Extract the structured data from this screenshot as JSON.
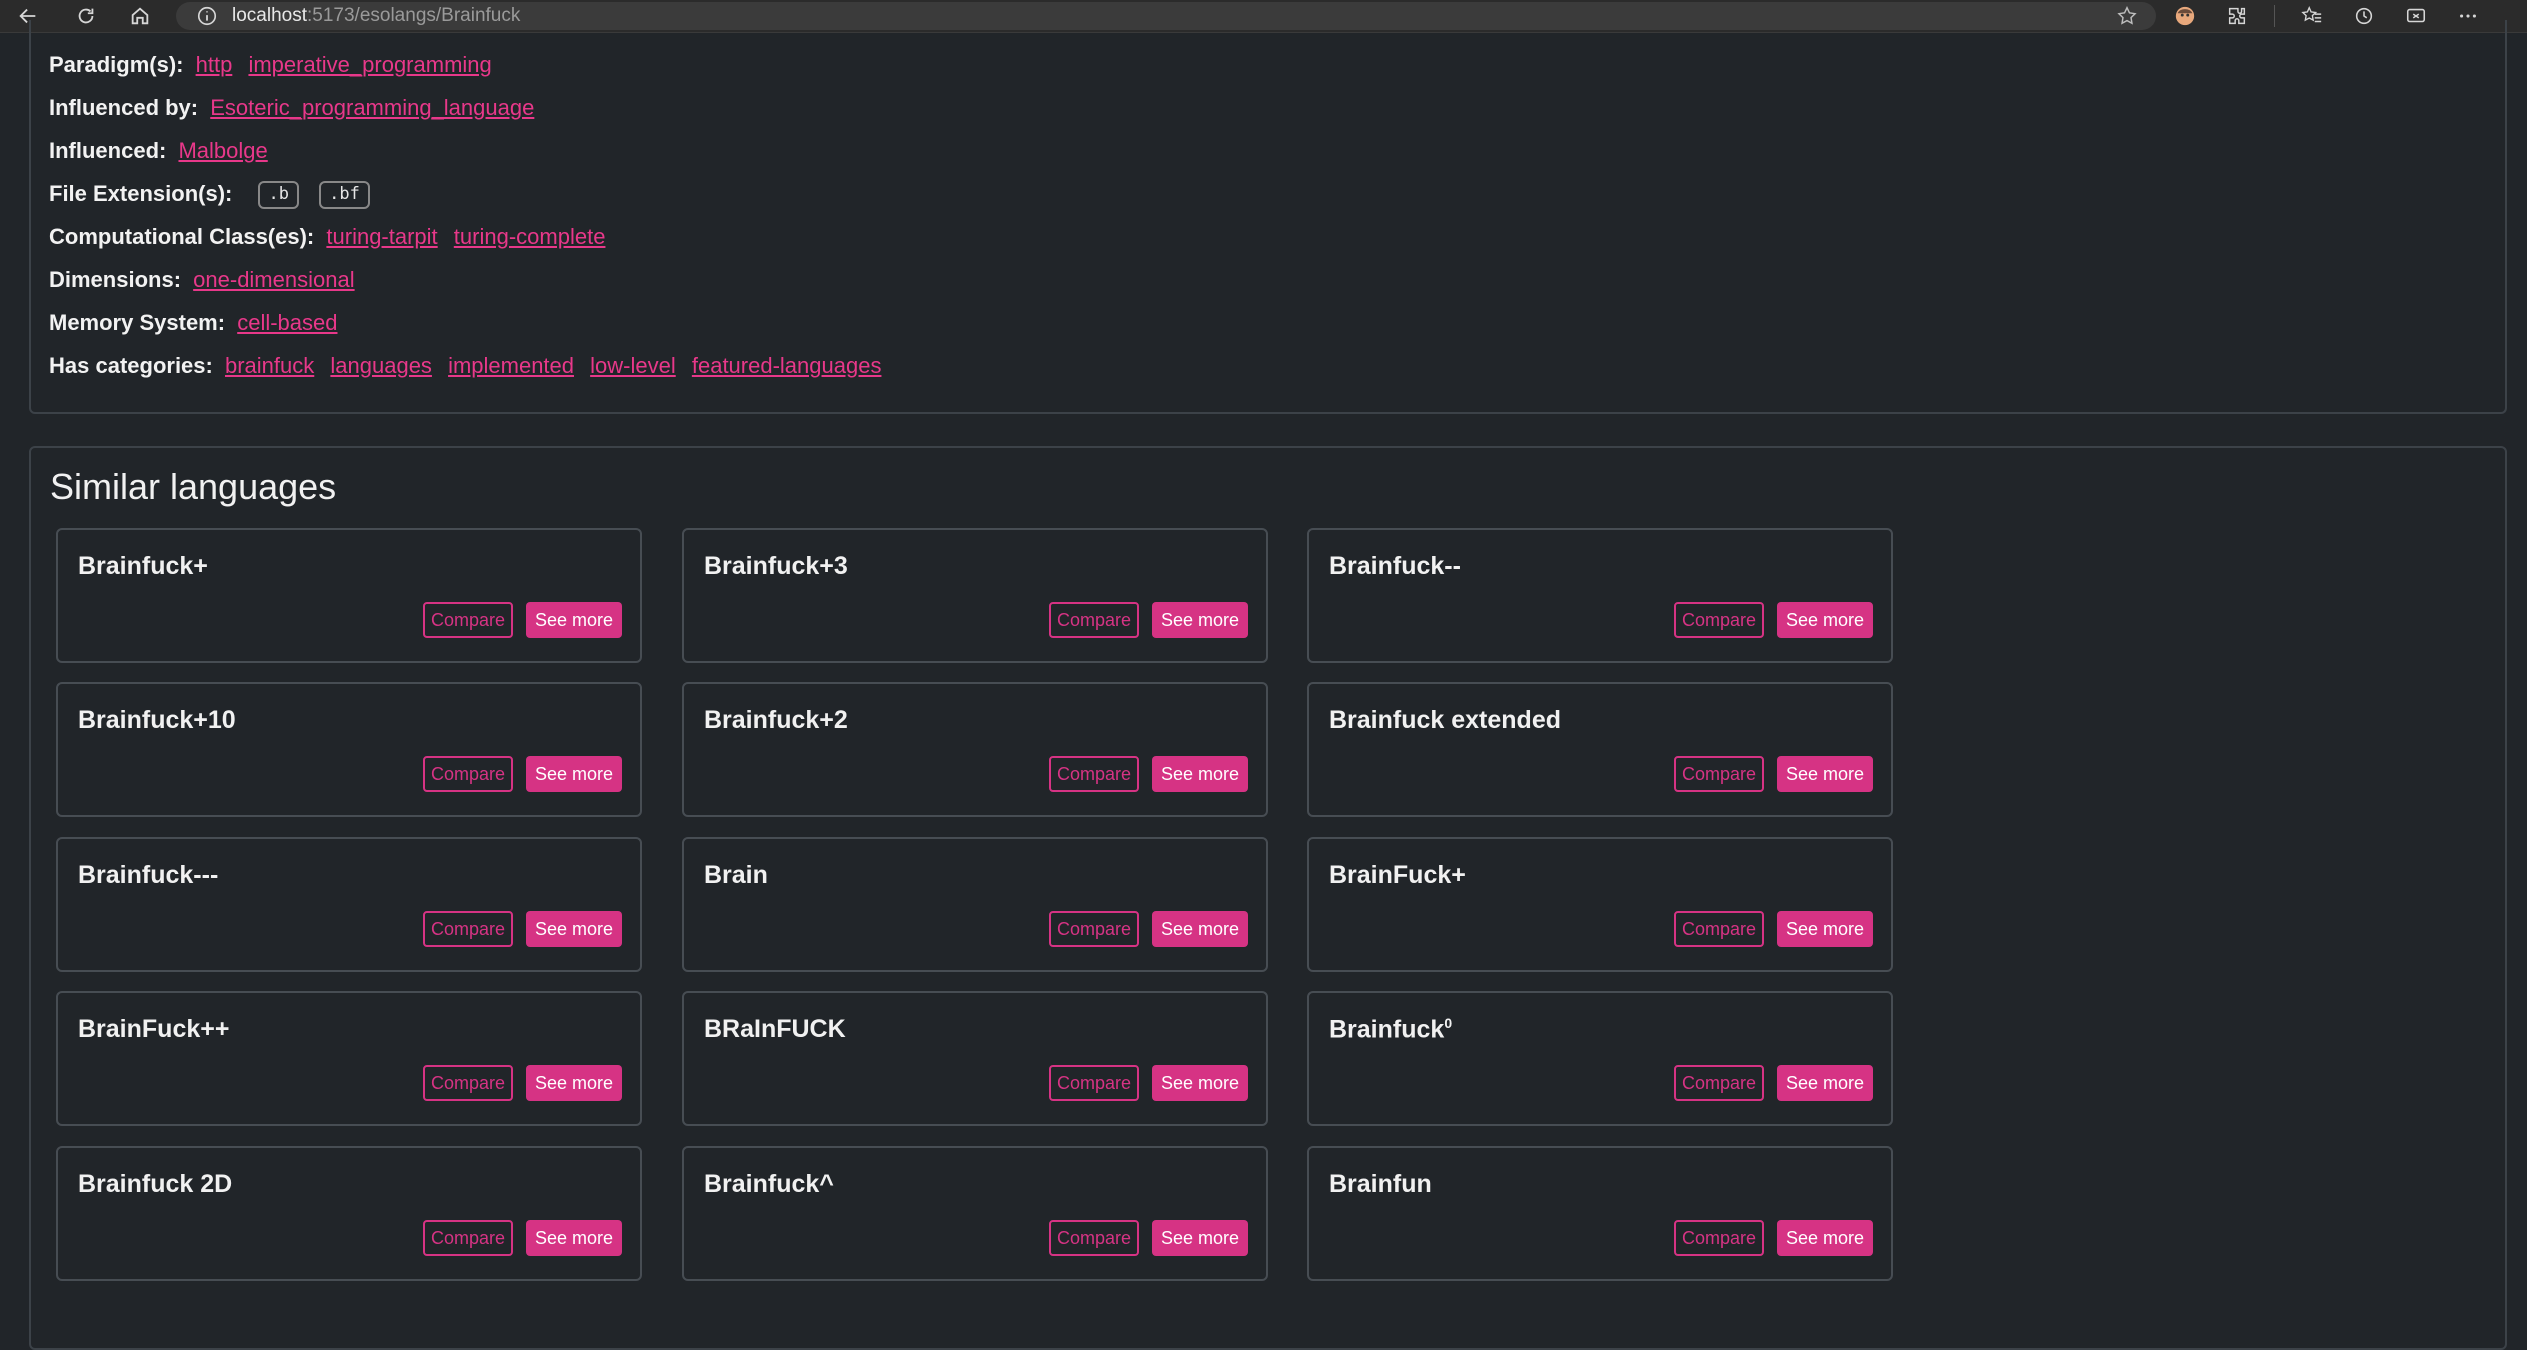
{
  "browser": {
    "url_host": "localhost",
    "url_rest": ":5173/esolangs/Brainfuck"
  },
  "info": {
    "paradigm_label": "Paradigm(s):",
    "paradigm_links": [
      "http",
      "imperative_programming"
    ],
    "influenced_by_label": "Influenced by:",
    "influenced_by_links": [
      "Esoteric_programming_language"
    ],
    "influenced_label": "Influenced:",
    "influenced_links": [
      "Malbolge"
    ],
    "file_ext_label": "File Extension(s):",
    "file_exts": [
      ".b",
      ".bf"
    ],
    "comp_class_label": "Computational Class(es):",
    "comp_class_links": [
      "turing-tarpit",
      "turing-complete"
    ],
    "dimensions_label": "Dimensions:",
    "dimensions_links": [
      "one-dimensional"
    ],
    "memory_label": "Memory System:",
    "memory_links": [
      "cell-based"
    ],
    "categories_label": "Has categories:",
    "categories_links": [
      "brainfuck",
      "languages",
      "implemented",
      "low-level",
      "featured-languages"
    ]
  },
  "similar": {
    "title": "Similar languages",
    "compare_label": "Compare",
    "see_more_label": "See more",
    "cards": [
      {
        "name": "Brainfuck+"
      },
      {
        "name": "Brainfuck+3"
      },
      {
        "name": "Brainfuck--"
      },
      {
        "name": "Brainfuck+10"
      },
      {
        "name": "Brainfuck+2"
      },
      {
        "name": "Brainfuck extended"
      },
      {
        "name": "Brainfuck---"
      },
      {
        "name": "Brain"
      },
      {
        "name": "BrainFuck+"
      },
      {
        "name": "BrainFuck++"
      },
      {
        "name": "BRaInFUCK"
      },
      {
        "name": "Brainfuck",
        "sup": "0"
      },
      {
        "name": "Brainfuck 2D"
      },
      {
        "name": "Brainfuck^"
      },
      {
        "name": "Brainfun"
      }
    ]
  }
}
